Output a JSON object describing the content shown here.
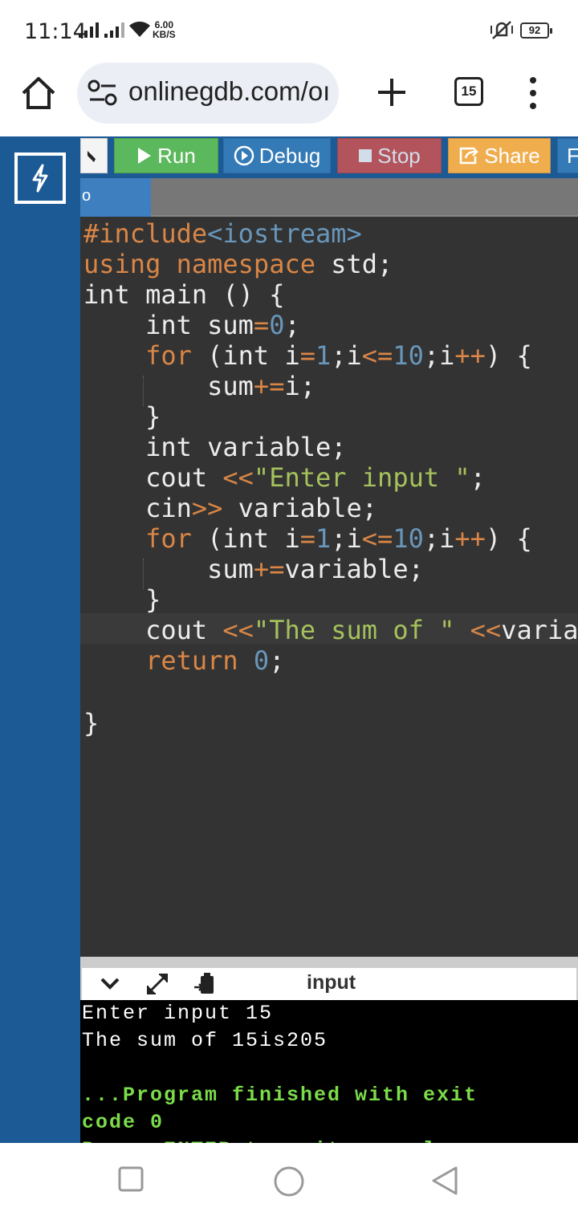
{
  "status_bar": {
    "time": "11:14",
    "net_speed_value": "6.00",
    "net_speed_unit": "KB/S",
    "battery": "92"
  },
  "browser": {
    "url": "onlinegdb.com/oı",
    "tab_count": "15"
  },
  "toolbar": {
    "run_label": "Run",
    "debug_label": "Debug",
    "stop_label": "Stop",
    "share_label": "Share",
    "more_label": "F"
  },
  "file_tab": {
    "label": "o"
  },
  "code_lines": [
    "#include<iostream>",
    "using namespace std;",
    "int main () {",
    "    int sum=0;",
    "    for (int i=1;i<=10;i++) {",
    "        sum+=i;",
    "    }",
    "    int variable;",
    "    cout <<\"Enter input \";",
    "    cin>> variable;",
    "    for (int i=1;i<=10;i++) {",
    "        sum+=variable;",
    "    }",
    "    cout <<\"The sum of \" <<varial",
    "    return 0;",
    "",
    "}"
  ],
  "output": {
    "panel_title": "input",
    "lines": [
      "Enter input 15",
      "The sum of 15is205",
      "",
      "...Program finished with exit",
      "code 0",
      "Press ENTER to exit console."
    ]
  },
  "colors": {
    "sidebar": "#1c5a95",
    "run": "#5cb85c",
    "debug": "#337ab7",
    "stop": "#d9534f",
    "share": "#f0ad4e",
    "editor_bg": "#333333",
    "keyword": "#d98646",
    "string": "#a5c25c",
    "number": "#6897bb",
    "console_finished": "#7bdc4a"
  }
}
